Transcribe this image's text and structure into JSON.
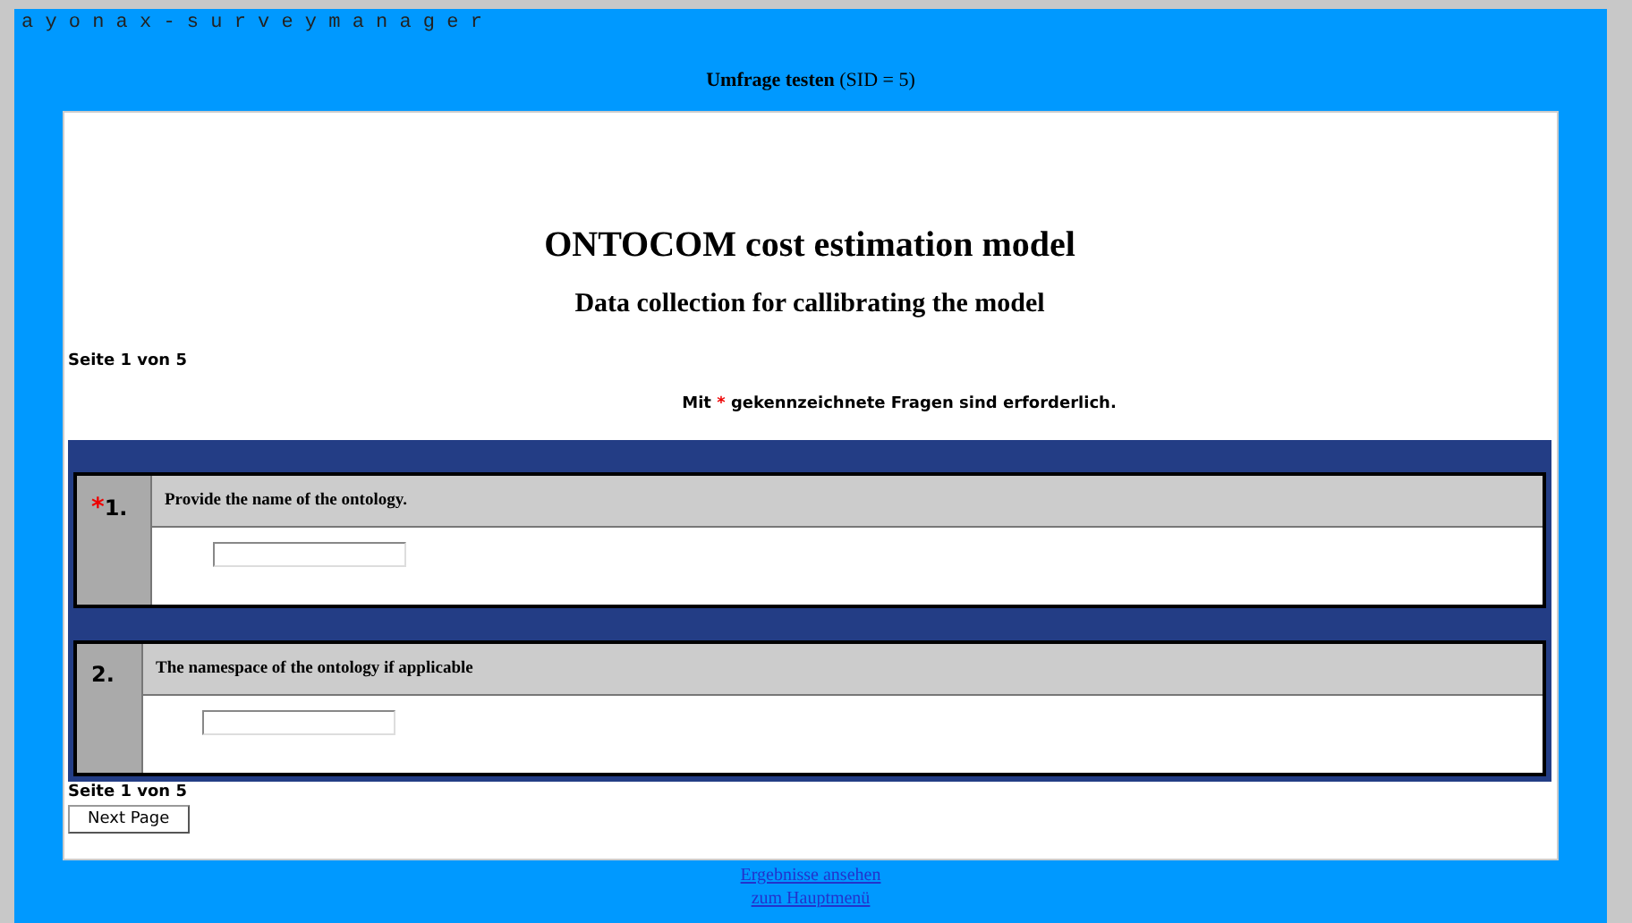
{
  "app_title": "a y o n a x - s u r v e y m a n a g e r",
  "page_heading": "**Umfrage testen** (SID = 5)",
  "survey": {
    "title": "ONTOCOM cost estimation model",
    "subtitle": "Data collection for callibrating the model",
    "page_indicator_top": "Seite 1 von 5",
    "required_note": {
      "before": "Mit",
      "mark": "*",
      "after": "gekennzeichnete Fragen sind erforderlich."
    },
    "questions": [
      {
        "mark": "*",
        "number": "1.",
        "text": "Provide the name of the ontology.",
        "required": true
      },
      {
        "number": "2.",
        "text": "The namespace of the ontology if applicable",
        "required": false
      }
    ],
    "page_indicator_bottom": "Seite 1 von 5",
    "next_button": "Next Page"
  },
  "links": [
    "Ergebnisse ansehen",
    "zum Hauptmenü"
  ]
}
